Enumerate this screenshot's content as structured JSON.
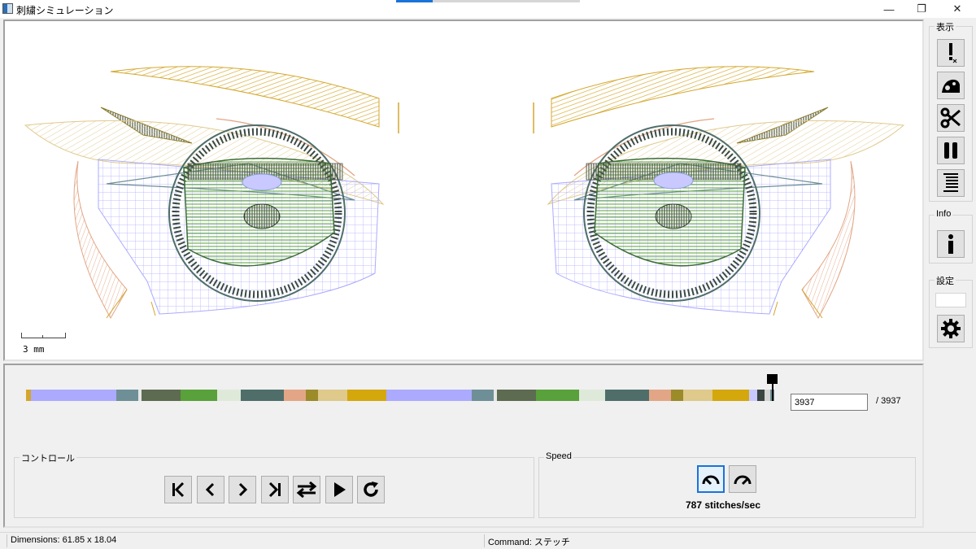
{
  "window": {
    "title": "刺繍シミュレーション"
  },
  "window_controls": {
    "minimize": "—",
    "maximize": "❐",
    "close": "✕"
  },
  "canvas": {
    "scale_label": "3 mm"
  },
  "side_panel": {
    "display_group": {
      "title": "表示",
      "buttons": [
        "warning-icon",
        "sewing-machine-icon",
        "scissors-icon",
        "pause-icon",
        "stitch-list-icon"
      ]
    },
    "info_group": {
      "title": "Info",
      "buttons": [
        "info-icon"
      ]
    },
    "settings_group": {
      "title": "設定",
      "buttons": [
        "gear-icon"
      ]
    }
  },
  "timeline": {
    "current_stitch": "3937",
    "total_label": "/ 3937",
    "thread_colors": [
      {
        "color": "#d4a72c",
        "weight": 0.6
      },
      {
        "color": "#abaaff",
        "weight": 11
      },
      {
        "color": "#6f8f97",
        "weight": 2.8
      },
      {
        "color": "#e6e6e6",
        "weight": 0.4
      },
      {
        "color": "#5d6b50",
        "weight": 5
      },
      {
        "color": "#59a13b",
        "weight": 4.8
      },
      {
        "color": "#dfe9d9",
        "weight": 3
      },
      {
        "color": "#4f6e6a",
        "weight": 5.5
      },
      {
        "color": "#e2a686",
        "weight": 2.8
      },
      {
        "color": "#9c8b29",
        "weight": 1.6
      },
      {
        "color": "#dfc98b",
        "weight": 3.8
      },
      {
        "color": "#d4a70c",
        "weight": 5
      },
      {
        "color": "#abaaff",
        "weight": 11
      },
      {
        "color": "#6f8f97",
        "weight": 2.8
      },
      {
        "color": "#e6e6e6",
        "weight": 0.4
      },
      {
        "color": "#5d6b50",
        "weight": 5
      },
      {
        "color": "#59a13b",
        "weight": 5.5
      },
      {
        "color": "#dfe9d9",
        "weight": 3.4
      },
      {
        "color": "#4f6e6a",
        "weight": 5.6
      },
      {
        "color": "#e2a686",
        "weight": 2.8
      },
      {
        "color": "#9c8b29",
        "weight": 1.6
      },
      {
        "color": "#dfc98b",
        "weight": 3.8
      },
      {
        "color": "#d4a70c",
        "weight": 4.7
      },
      {
        "color": "#c9c9ff",
        "weight": 1
      },
      {
        "color": "#3a4440",
        "weight": 1
      },
      {
        "color": "#d4d4d4",
        "weight": 0.7
      },
      {
        "color": "#6f8f97",
        "weight": 0.5
      }
    ]
  },
  "controls": {
    "title": "コントロール",
    "buttons": [
      "skip-to-start-icon",
      "step-back-icon",
      "step-forward-icon",
      "skip-to-end-icon",
      "swap-icon",
      "play-icon",
      "reload-icon"
    ]
  },
  "speed": {
    "title": "Speed",
    "buttons": [
      "speed-slow-icon",
      "speed-fast-icon"
    ],
    "value_text": "787 stitches/sec"
  },
  "status_bar": {
    "dimensions": "Dimensions: 61.85 x 18.04",
    "command": "Command: ステッチ"
  }
}
